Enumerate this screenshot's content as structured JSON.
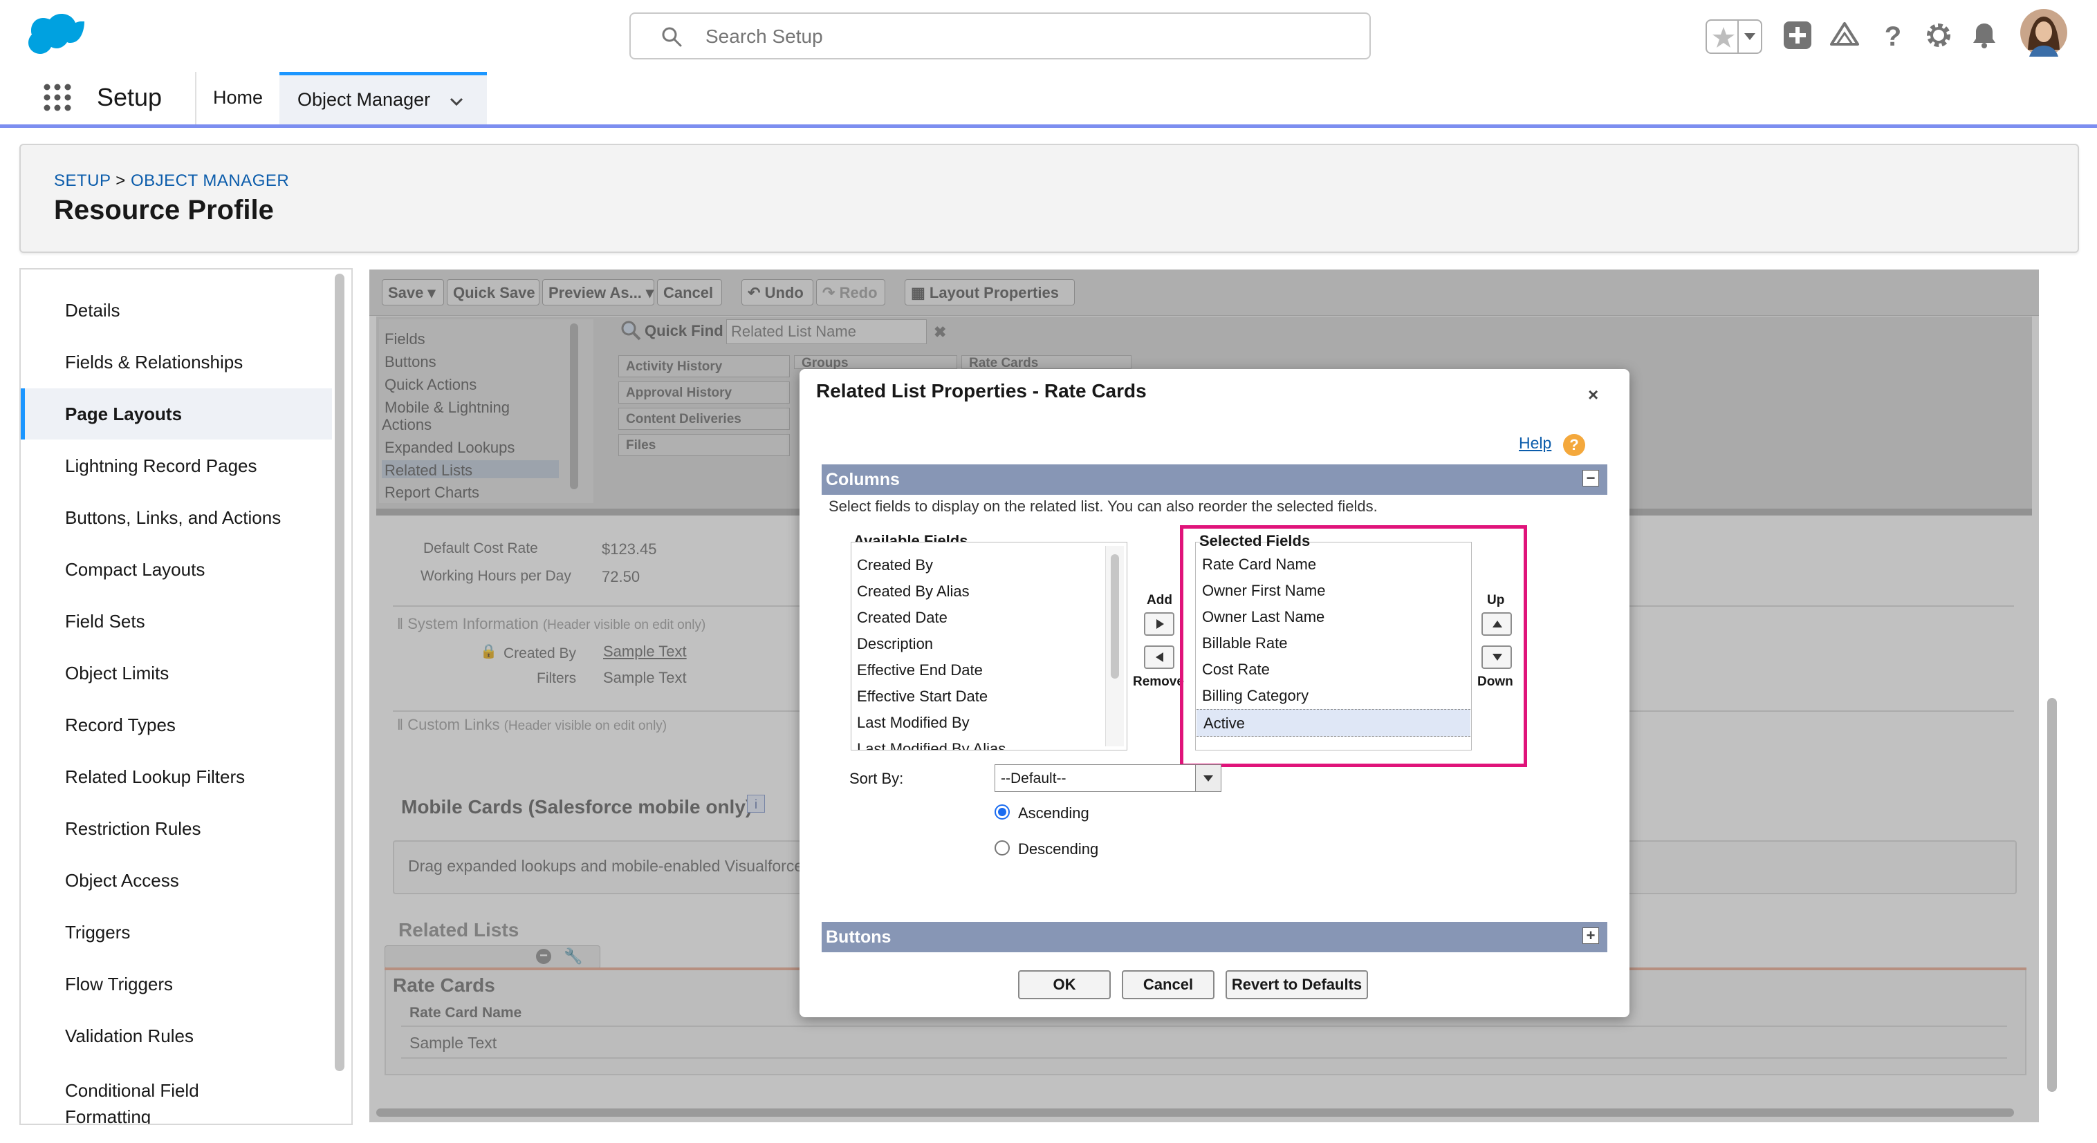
{
  "header": {
    "search_placeholder": "Search Setup"
  },
  "nav": {
    "app_name": "Setup",
    "home": "Home",
    "object_manager": "Object Manager"
  },
  "page": {
    "breadcrumb_setup": "SETUP",
    "breadcrumb_sep": ">",
    "breadcrumb_om": "OBJECT MANAGER",
    "title": "Resource Profile"
  },
  "sidebar": {
    "items": [
      {
        "label": "Details"
      },
      {
        "label": "Fields & Relationships"
      },
      {
        "label": "Page Layouts"
      },
      {
        "label": "Lightning Record Pages"
      },
      {
        "label": "Buttons, Links, and Actions"
      },
      {
        "label": "Compact Layouts"
      },
      {
        "label": "Field Sets"
      },
      {
        "label": "Object Limits"
      },
      {
        "label": "Record Types"
      },
      {
        "label": "Related Lookup Filters"
      },
      {
        "label": "Restriction Rules"
      },
      {
        "label": "Object Access"
      },
      {
        "label": "Triggers"
      },
      {
        "label": "Flow Triggers"
      },
      {
        "label": "Validation Rules"
      },
      {
        "label": "Conditional Field Formatting"
      }
    ],
    "active_index": 2
  },
  "editor": {
    "toolbar": {
      "save": "Save",
      "quick_save": "Quick Save",
      "preview_as": "Preview As...",
      "cancel": "Cancel",
      "undo": "Undo",
      "redo": "Redo",
      "layout_properties": "Layout Properties"
    },
    "palette_categories": [
      "Fields",
      "Buttons",
      "Quick Actions",
      "Mobile & Lightning",
      "Actions",
      "Expanded Lookups",
      "Related Lists",
      "Report Charts"
    ],
    "quick_find_label": "Quick Find",
    "quick_find_placeholder": "Related List Name",
    "palette_fields": [
      "Activity History",
      "Approval History",
      "Content Deliveries",
      "Files",
      "Groups",
      "Rate Cards"
    ],
    "fields": [
      {
        "label": "Default Cost Rate",
        "value": "$123.45"
      },
      {
        "label": "Working Hours per Day",
        "value": "72.50"
      }
    ],
    "system_info": "System Information",
    "system_info_note": "(Header visible on edit only)",
    "created_by_label": "Created By",
    "created_by_value": "Sample Text",
    "filters_label": "Filters",
    "filters_value": "Sample Text",
    "custom_links": "Custom Links",
    "custom_links_note": "(Header visible on edit only)",
    "mobile_cards_title": "Mobile Cards (Salesforce mobile only)",
    "mobile_cards_text": "Drag expanded lookups and mobile-enabled Visualforce",
    "related_lists_title": "Related Lists",
    "rate_cards_title": "Rate Cards",
    "rate_cards_col": "Rate Card Name",
    "rate_cards_cell": "Sample Text"
  },
  "dialog": {
    "title": "Related List Properties - Rate Cards",
    "close": "×",
    "help": "Help",
    "help_icon": "?",
    "columns_section": "Columns",
    "columns_toggle": "−",
    "columns_desc": "Select fields to display on the related list. You can also reorder the selected fields.",
    "available_label": "Available Fields",
    "available_fields": [
      "Created By",
      "Created By Alias",
      "Created Date",
      "Description",
      "Effective End Date",
      "Effective Start Date",
      "Last Modified By",
      "Last Modified By Alias"
    ],
    "add_label": "Add",
    "remove_label": "Remove",
    "selected_label": "Selected Fields",
    "selected_fields": [
      "Rate Card Name",
      "Owner First Name",
      "Owner Last Name",
      "Billable Rate",
      "Cost Rate",
      "Billing Category",
      "Active"
    ],
    "selected_active_index": 6,
    "up_label": "Up",
    "down_label": "Down",
    "sort_by_label": "Sort By:",
    "sort_by_value": "--Default--",
    "ascending": "Ascending",
    "descending": "Descending",
    "sort_order_selected": "Ascending",
    "buttons_section": "Buttons",
    "buttons_toggle": "+",
    "ok": "OK",
    "cancel": "Cancel",
    "revert": "Revert to Defaults"
  },
  "colors": {
    "accent": "#1b96ff",
    "highlight": "#e0137a",
    "section_bar": "#8796b5"
  }
}
